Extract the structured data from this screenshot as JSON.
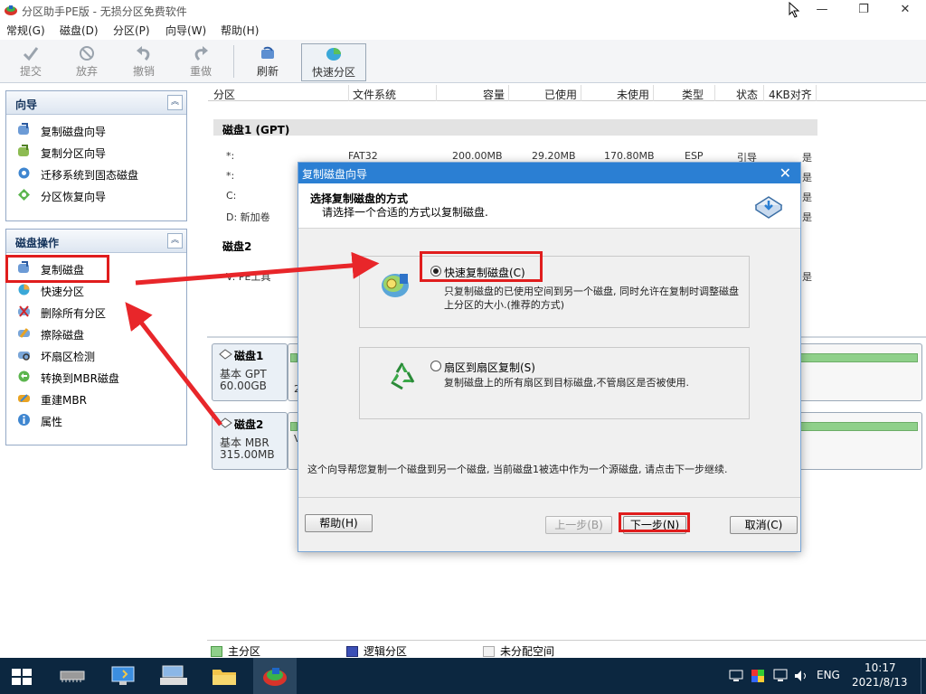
{
  "window": {
    "title": "分区助手PE版 - 无损分区免费软件",
    "controls": {
      "minimize": "—",
      "maximize": "❐",
      "close": "✕"
    }
  },
  "menu": [
    "常规(G)",
    "磁盘(D)",
    "分区(P)",
    "向导(W)",
    "帮助(H)"
  ],
  "toolbar": {
    "commit": "提交",
    "discard": "放弃",
    "undo": "撤销",
    "redo": "重做",
    "refresh": "刷新",
    "quick_partition": "快速分区"
  },
  "sidebar": {
    "wizard": {
      "title": "向导",
      "items": [
        "复制磁盘向导",
        "复制分区向导",
        "迁移系统到固态磁盘",
        "分区恢复向导"
      ]
    },
    "disk_ops": {
      "title": "磁盘操作",
      "items": [
        "复制磁盘",
        "快速分区",
        "删除所有分区",
        "擦除磁盘",
        "坏扇区检测",
        "转换到MBR磁盘",
        "重建MBR",
        "属性"
      ]
    }
  },
  "columns": [
    "分区",
    "文件系统",
    "容量",
    "已使用",
    "未使用",
    "类型",
    "状态",
    "4KB对齐"
  ],
  "disk1": {
    "label": "磁盘1 (GPT)",
    "rows": [
      {
        "name": "*:",
        "fs": "FAT32",
        "cap": "200.00MB",
        "used": "29.20MB",
        "free": "170.80MB",
        "type": "ESP",
        "status": "引导",
        "align": "是"
      },
      {
        "name": "*:",
        "align": "是"
      },
      {
        "name": "C:",
        "align": "是"
      },
      {
        "name": "D: 新加卷",
        "align": "是"
      }
    ]
  },
  "disk2": {
    "label": "磁盘2",
    "rows": [
      {
        "name": "V: PE工具",
        "align": "是"
      }
    ]
  },
  "diskmap": [
    {
      "name": "磁盘1",
      "type": "基本 GPT",
      "size": "60.00GB",
      "frag": "2"
    },
    {
      "name": "磁盘2",
      "type": "基本 MBR",
      "size": "315.00MB",
      "frag": "V"
    }
  ],
  "legend": [
    "主分区",
    "逻辑分区",
    "未分配空间"
  ],
  "dialog": {
    "title": "复制磁盘向导",
    "heading": "选择复制磁盘的方式",
    "subheading": "请选择一个合适的方式以复制磁盘.",
    "option1": {
      "label": "快速复制磁盘(C)",
      "desc": "只复制磁盘的已使用空间到另一个磁盘, 同时允许在复制时调整磁盘上分区的大小.(推荐的方式)",
      "selected": true
    },
    "option2": {
      "label": "扇区到扇区复制(S)",
      "desc": "复制磁盘上的所有扇区到目标磁盘,不管扇区是否被使用.",
      "selected": false
    },
    "info": "这个向导帮您复制一个磁盘到另一个磁盘, 当前磁盘1被选中作为一个源磁盘, 请点击下一步继续.",
    "buttons": {
      "help": "帮助(H)",
      "back": "上一步(B)",
      "next": "下一步(N)",
      "cancel": "取消(C)"
    }
  },
  "taskbar": {
    "time": "10:17",
    "date": "2021/8/13",
    "lang": "ENG"
  },
  "colors": {
    "accent": "#2b7fd3",
    "annotation": "#e01d1d",
    "primary_partition": "#8fd08a",
    "logical_partition": "#3b4fb5",
    "taskbar": "#0c2740"
  }
}
